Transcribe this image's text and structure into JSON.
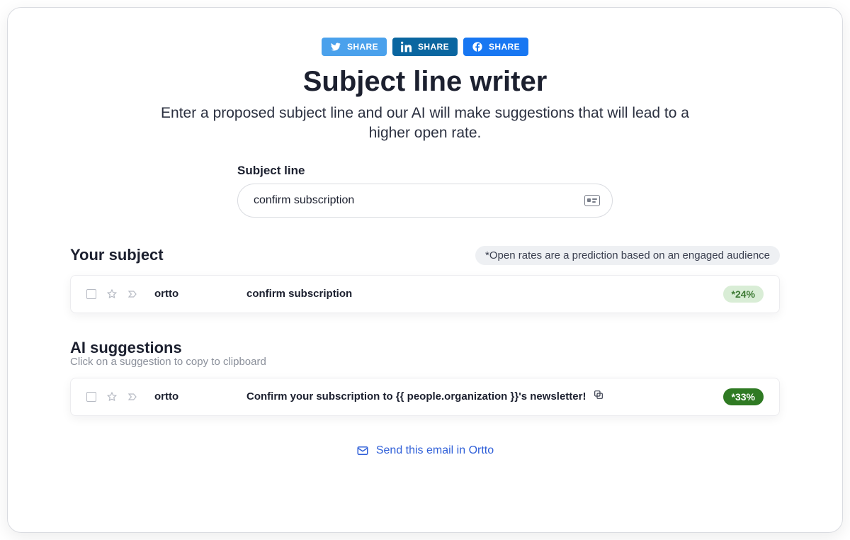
{
  "share": {
    "twitter": "SHARE",
    "linkedin": "SHARE",
    "facebook": "SHARE"
  },
  "header": {
    "title": "Subject line writer",
    "subtitle": "Enter a proposed subject line and our AI will make suggestions that will lead to a higher open rate."
  },
  "field": {
    "label": "Subject line",
    "value": "confirm subscription"
  },
  "your_subject": {
    "heading": "Your subject",
    "note": "*Open rates are a prediction based on an engaged audience",
    "sender": "ortto",
    "text": "confirm subscription",
    "rate": "*24%"
  },
  "ai": {
    "heading": "AI suggestions",
    "hint": "Click on a suggestion to copy to clipboard",
    "sender": "ortto",
    "text": "Confirm your subscription to {{ people.organization }}'s newsletter!",
    "rate": "*33%"
  },
  "footer": {
    "send_link": "Send this email in Ortto"
  }
}
